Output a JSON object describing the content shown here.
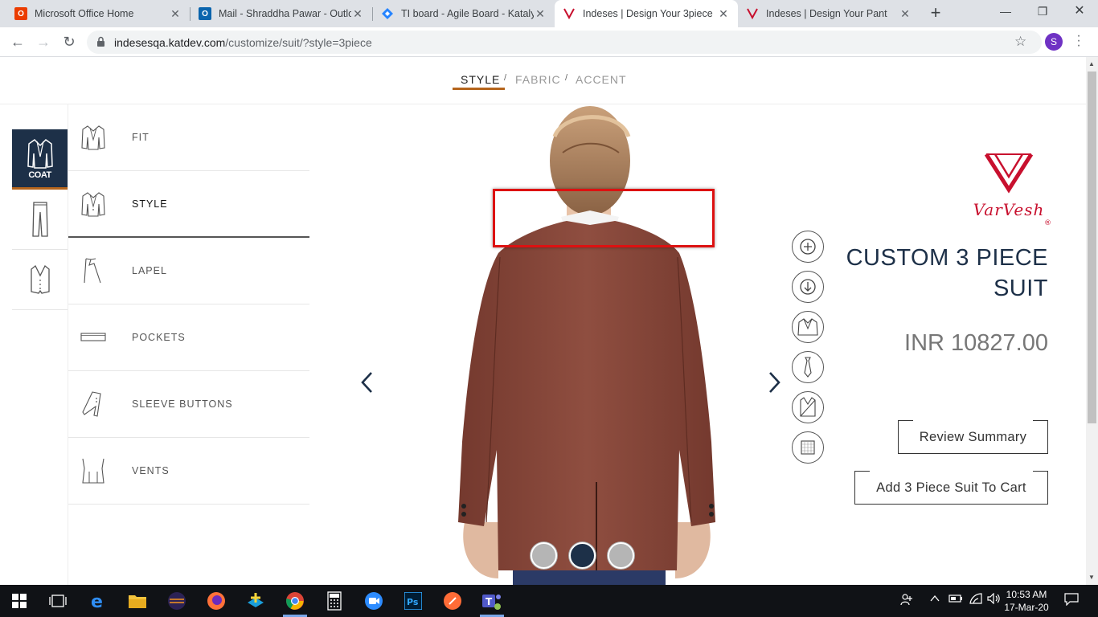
{
  "browser": {
    "tabs": [
      {
        "title": "Microsoft Office Home",
        "icon": "office-icon"
      },
      {
        "title": "Mail - Shraddha Pawar - Outlo",
        "icon": "outlook-icon"
      },
      {
        "title": "TI board - Agile Board - Kataly",
        "icon": "jira-icon"
      },
      {
        "title": "Indeses | Design Your 3piece",
        "icon": "varvesh-icon",
        "active": true
      },
      {
        "title": "Indeses | Design Your Pant",
        "icon": "varvesh-icon"
      }
    ],
    "url_host": "indesesqa.katdev.com",
    "url_path": "/customize/suit/?style=3piece",
    "profile_initial": "S"
  },
  "steps": [
    {
      "label": "STYLE",
      "active": true
    },
    {
      "label": "FABRIC"
    },
    {
      "label": "ACCENT"
    }
  ],
  "step_separator": "/",
  "categories": [
    {
      "label": "COAT",
      "icon": "coat-icon",
      "active": true
    },
    {
      "label": "",
      "icon": "trouser-icon"
    },
    {
      "label": "",
      "icon": "vest-icon"
    }
  ],
  "options": [
    {
      "label": "FIT",
      "icon": "fit-icon"
    },
    {
      "label": "STYLE",
      "icon": "style-icon",
      "active": true
    },
    {
      "label": "LAPEL",
      "icon": "lapel-icon"
    },
    {
      "label": "POCKETS",
      "icon": "pockets-icon"
    },
    {
      "label": "SLEEVE BUTTONS",
      "icon": "sleeve-buttons-icon"
    },
    {
      "label": "VENTS",
      "icon": "vents-icon"
    }
  ],
  "viewer": {
    "prev_icon": "chevron-left-icon",
    "next_icon": "chevron-right-icon",
    "view_dots": 3,
    "active_dot": 1
  },
  "tools": [
    "zoom-in-icon",
    "download-icon",
    "jacket-view-icon",
    "tie-icon",
    "vest-view-icon",
    "fabric-swatch-icon"
  ],
  "product": {
    "brand": "VarVesh",
    "brand_mark": "®",
    "title_line1": "CUSTOM 3 PIECE",
    "title_line2": "SUIT",
    "price": "INR 10827.00",
    "review_label": "Review Summary",
    "cart_label": "Add 3 Piece Suit To Cart"
  },
  "colors": {
    "navy": "#1d3048",
    "accent": "#b5651d",
    "suit": "#8a4a3c",
    "highlight": "#dd1111"
  },
  "taskbar": {
    "time": "10:53 AM",
    "date": "17-Mar-20"
  }
}
